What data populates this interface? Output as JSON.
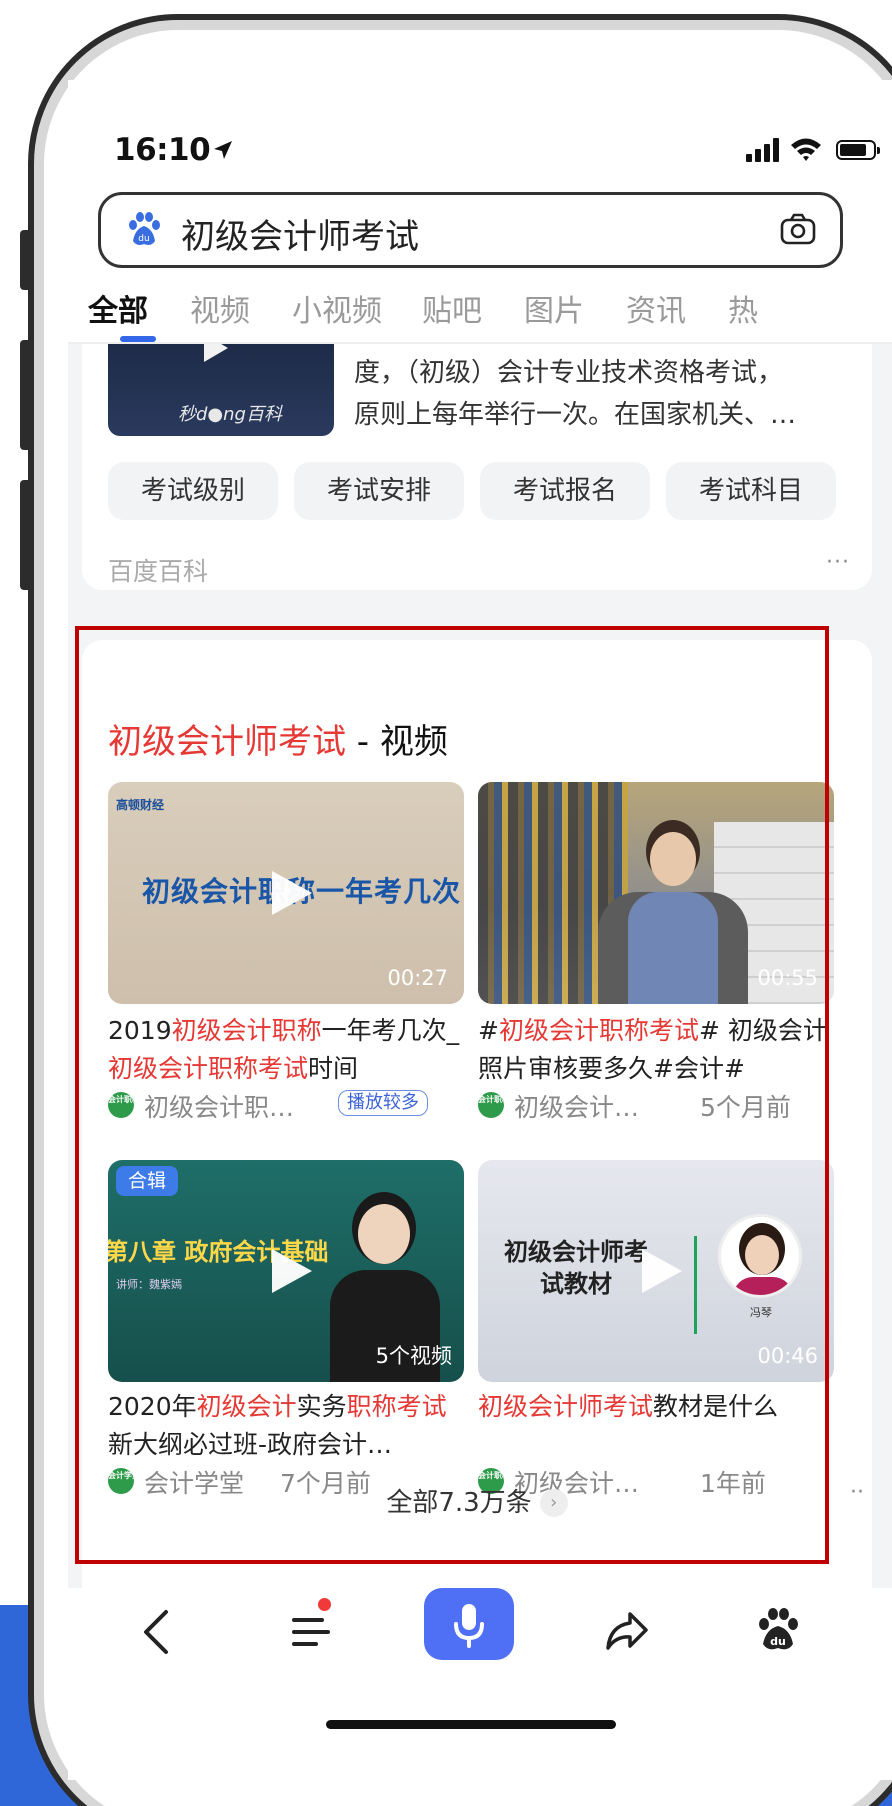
{
  "status_bar": {
    "time": "16:10"
  },
  "search": {
    "query": "初级会计师考试"
  },
  "tabs": [
    {
      "label": "全部",
      "active": true
    },
    {
      "label": "视频"
    },
    {
      "label": "小视频"
    },
    {
      "label": "贴吧"
    },
    {
      "label": "图片"
    },
    {
      "label": "资讯"
    },
    {
      "label": "热"
    }
  ],
  "baike": {
    "thumb_brand": "秒d●ng百科",
    "description_line1": "度，（初级）会计专业技术资格考试，",
    "description_line2": "原则上每年举行一次。在国家机关、…",
    "chips": [
      "考试级别",
      "考试安排",
      "考试报名",
      "考试科目"
    ],
    "source": "百度百科",
    "more": "···"
  },
  "video_section": {
    "title_highlight": "初级会计师考试",
    "title_rest": " - 视频",
    "all_link": "全部7.3万条",
    "all_link_chevron": "›",
    "more": "··",
    "videos": [
      {
        "thumb_brand": "高顿财经",
        "thumb_text": "初级会计职称一年考几次",
        "duration": "00:27",
        "title_parts": [
          {
            "text": "2019"
          },
          {
            "text": "初级会计职称",
            "hl": true
          },
          {
            "text": "一年考几次_"
          },
          {
            "text": "初级会计职称考试",
            "hl": true
          },
          {
            "text": "时间"
          }
        ],
        "source_icon": "会计职称",
        "source": "初级会计职…",
        "pill": "播放较多"
      },
      {
        "duration": "00:55",
        "title_parts": [
          {
            "text": "#"
          },
          {
            "text": "初级会计职称考试",
            "hl": true
          },
          {
            "text": "# 初级会计照片审核要多久#会计#"
          }
        ],
        "source_icon": "会计职称",
        "source": "初级会计…",
        "when": "5个月前"
      },
      {
        "badge": "合辑",
        "thumb_text": "第八章  政府会计基础",
        "thumb_teacher": "讲师：魏紫嫣",
        "count": "5个视频",
        "title_parts": [
          {
            "text": "2020年"
          },
          {
            "text": "初级会计",
            "hl": true
          },
          {
            "text": "实务"
          },
          {
            "text": "职称考试",
            "hl": true
          },
          {
            "text": "新大纲必过班-政府会计…"
          }
        ],
        "source_icon": "会计学堂",
        "source": "会计学堂",
        "when": "7个月前"
      },
      {
        "thumb_text": "初级会计师考试教材",
        "thumb_name": "冯琴",
        "duration": "00:46",
        "title_parts": [
          {
            "text": "初级会计师考试",
            "hl": true
          },
          {
            "text": "教材是什么"
          }
        ],
        "source_icon": "会计职称",
        "source": "初级会计…",
        "when": "1年前"
      }
    ]
  },
  "toolbar": {
    "icons": [
      "back-icon",
      "menu-icon",
      "microphone-icon",
      "share-icon",
      "baidu-paw-icon"
    ]
  },
  "colors": {
    "highlight_red": "#e53935",
    "accent_blue": "#3367e8",
    "frame_red": "#c00000",
    "mic_blue": "#4f6ff5"
  }
}
